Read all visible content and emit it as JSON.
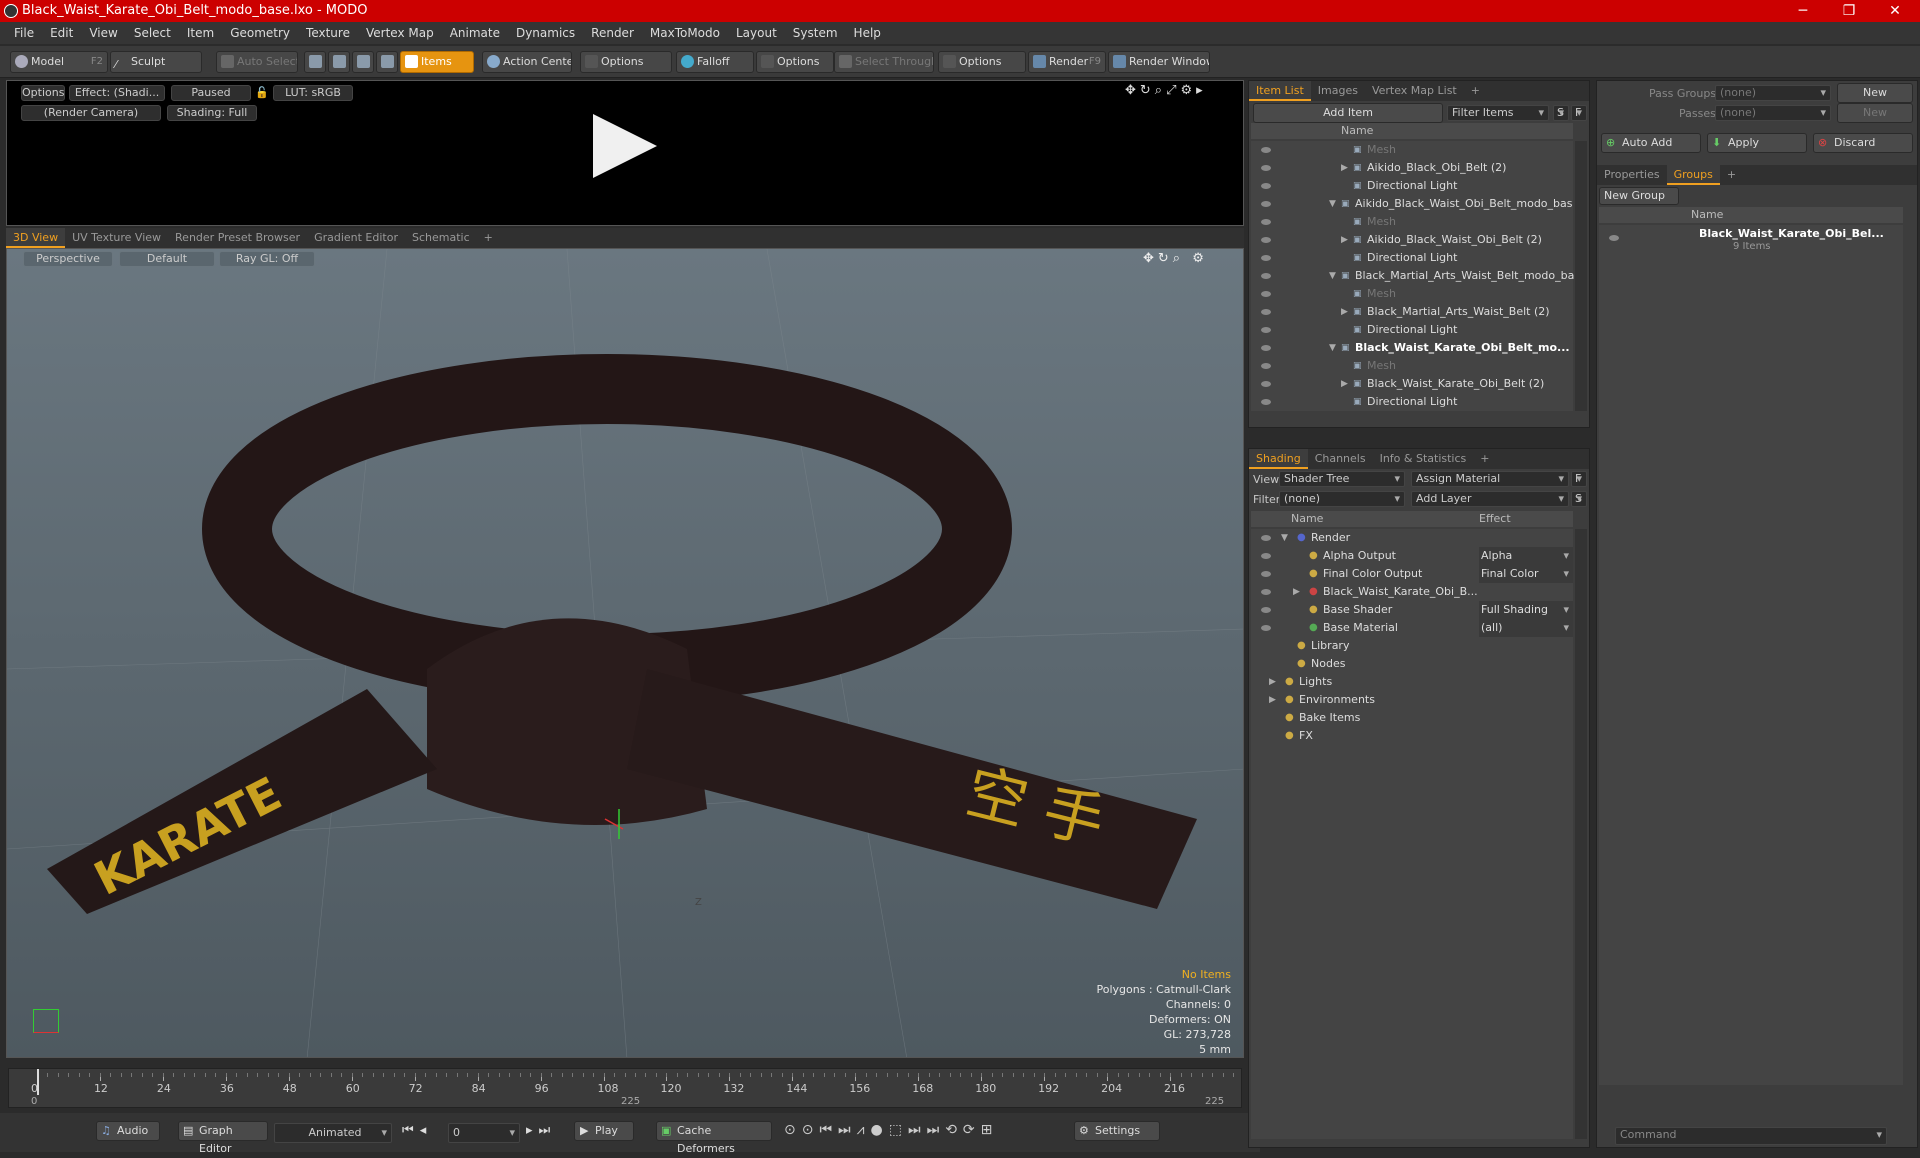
{
  "title": "Black_Waist_Karate_Obi_Belt_modo_base.lxo - MODO",
  "menu": [
    "File",
    "Edit",
    "View",
    "Select",
    "Item",
    "Geometry",
    "Texture",
    "Vertex Map",
    "Animate",
    "Dynamics",
    "Render",
    "MaxToModo",
    "Layout",
    "System",
    "Help"
  ],
  "toolbar": {
    "model": "Model",
    "model_key": "F2",
    "sculpt": "Sculpt",
    "auto_select": "Auto Select",
    "items": "Items",
    "action_center": "Action Center",
    "options1": "Options",
    "falloff": "Falloff",
    "options2": "Options",
    "select_through": "Select Through",
    "options3": "Options",
    "render": "Render",
    "render_key": "F9",
    "render_window": "Render Window"
  },
  "preview": {
    "options": "Options",
    "effect": "Effect: (Shadi...",
    "paused": "Paused",
    "lut": "LUT: sRGB",
    "camera": "(Render Camera)",
    "shading": "Shading: Full"
  },
  "viewtabs": [
    "3D View",
    "UV Texture View",
    "Render Preset Browser",
    "Gradient Editor",
    "Schematic",
    "+"
  ],
  "viewport": {
    "perspective": "Perspective",
    "default": "Default",
    "raygl": "Ray GL: Off",
    "no_items": "No Items",
    "polygons": "Polygons : Catmull-Clark",
    "channels": "Channels: 0",
    "deformers": "Deformers: ON",
    "gl": "GL: 273,728",
    "mm": "5 mm",
    "karate": "KARATE",
    "kanji": "空 手",
    "axis_z": "Z"
  },
  "timeline": {
    "ticks": [
      "0",
      "12",
      "24",
      "36",
      "48",
      "60",
      "72",
      "84",
      "96",
      "108",
      "120",
      "132",
      "144",
      "156",
      "168",
      "180",
      "192",
      "204",
      "216"
    ],
    "start": "0",
    "mid": "225",
    "end": "225"
  },
  "transport": {
    "audio": "Audio",
    "graph": "Graph Editor",
    "animated": "Animated",
    "frame": "0",
    "play": "Play",
    "cache": "Cache Deformers",
    "settings": "Settings"
  },
  "itemlist": {
    "tabs": [
      "Item List",
      "Images",
      "Vertex Map List",
      "+"
    ],
    "add_item": "Add Item",
    "filter_items": "Filter Items",
    "s": "S",
    "f": "F",
    "col_name": "Name",
    "rows": [
      {
        "t": "Mesh",
        "ind": 110,
        "dim": true,
        "exp": ""
      },
      {
        "t": "Aikido_Black_Obi_Belt (2)",
        "ind": 110,
        "exp": "▶"
      },
      {
        "t": "Directional Light",
        "ind": 110,
        "exp": ""
      },
      {
        "t": "Aikido_Black_Waist_Obi_Belt_modo_bas ...",
        "ind": 98,
        "exp": "▼"
      },
      {
        "t": "Mesh",
        "ind": 110,
        "dim": true,
        "exp": ""
      },
      {
        "t": "Aikido_Black_Waist_Obi_Belt (2)",
        "ind": 110,
        "exp": "▶"
      },
      {
        "t": "Directional Light",
        "ind": 110,
        "exp": ""
      },
      {
        "t": "Black_Martial_Arts_Waist_Belt_modo_ba...",
        "ind": 98,
        "exp": "▼"
      },
      {
        "t": "Mesh",
        "ind": 110,
        "dim": true,
        "exp": ""
      },
      {
        "t": "Black_Martial_Arts_Waist_Belt (2)",
        "ind": 110,
        "exp": "▶"
      },
      {
        "t": "Directional Light",
        "ind": 110,
        "exp": ""
      },
      {
        "t": "Black_Waist_Karate_Obi_Belt_mo...",
        "ind": 98,
        "exp": "▼",
        "bold": true
      },
      {
        "t": "Mesh",
        "ind": 110,
        "dim": true,
        "exp": ""
      },
      {
        "t": "Black_Waist_Karate_Obi_Belt (2)",
        "ind": 110,
        "exp": "▶"
      },
      {
        "t": "Directional Light",
        "ind": 110,
        "exp": ""
      }
    ]
  },
  "shading": {
    "tabs": [
      "Shading",
      "Channels",
      "Info & Statistics",
      "+"
    ],
    "view_label": "View",
    "view_value": "Shader Tree",
    "assign": "Assign Material",
    "filter_label": "Filter",
    "filter_value": "(none)",
    "add_layer": "Add Layer",
    "f": "F",
    "s": "S",
    "col_name": "Name",
    "col_effect": "Effect",
    "rows": [
      {
        "t": "Render",
        "effect": "",
        "ind": 48,
        "exp": "▼"
      },
      {
        "t": "Alpha Output",
        "effect": "Alpha",
        "ind": 60,
        "exp": ""
      },
      {
        "t": "Final Color Output",
        "effect": "Final Color",
        "ind": 60,
        "exp": ""
      },
      {
        "t": "Black_Waist_Karate_Obi_B...",
        "effect": "",
        "ind": 60,
        "exp": "▶"
      },
      {
        "t": "Base Shader",
        "effect": "Full Shading",
        "ind": 60,
        "exp": ""
      },
      {
        "t": "Base Material",
        "effect": "(all)",
        "ind": 60,
        "exp": ""
      },
      {
        "t": "Library",
        "effect": "",
        "ind": 48,
        "exp": ""
      },
      {
        "t": "Nodes",
        "effect": "",
        "ind": 48,
        "exp": ""
      },
      {
        "t": "Lights",
        "effect": "",
        "ind": 36,
        "exp": "▶"
      },
      {
        "t": "Environments",
        "effect": "",
        "ind": 36,
        "exp": "▶"
      },
      {
        "t": "Bake Items",
        "effect": "",
        "ind": 36,
        "exp": ""
      },
      {
        "t": "FX",
        "effect": "",
        "ind": 36,
        "exp": ""
      }
    ]
  },
  "right": {
    "pass_groups": "Pass Groups",
    "none1": "(none)",
    "new1": "New",
    "passes": "Passes",
    "none2": "(none)",
    "new2": "New",
    "auto_add": "Auto Add",
    "apply": "Apply",
    "discard": "Discard",
    "tabs": [
      "Properties",
      "Groups",
      "+"
    ],
    "new_group": "New Group",
    "col_name": "Name",
    "group_name": "Black_Waist_Karate_Obi_Bel...",
    "group_count": "9 Items",
    "command": "Command"
  }
}
